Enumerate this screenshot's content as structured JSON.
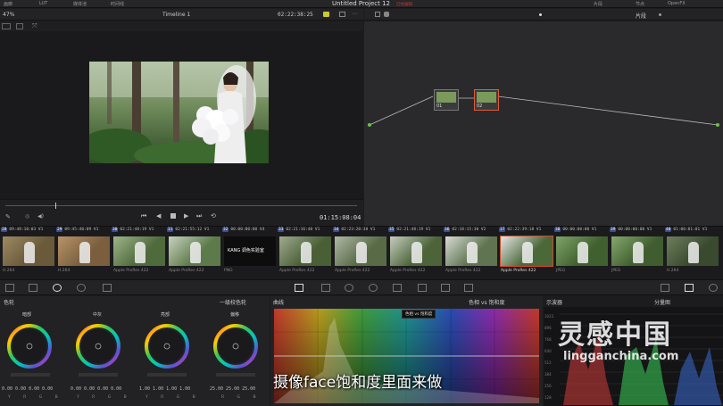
{
  "topbar": {
    "gallery": "画廊",
    "lut": "LUT",
    "media_pool": "媒体池",
    "timeline": "时间线",
    "project_title": "Untitled Project 12",
    "unsaved": "已经编辑",
    "clips": "片段",
    "nodes": "节点",
    "openfx": "OpenFX"
  },
  "viewer": {
    "zoom": "47%",
    "timeline_name": "Timeline 1",
    "timecode_top": "02:22:38:25",
    "timecode_main": "01:15:08:04"
  },
  "nodegraph": {
    "mode": "片段",
    "node1_label": "01",
    "node2_label": "02"
  },
  "clips": [
    {
      "num": "28",
      "tc": "09:48:10:03",
      "track": "V1",
      "codec": "H.264"
    },
    {
      "num": "29",
      "tc": "09:45:40:09",
      "track": "V1",
      "codec": "H.264"
    },
    {
      "num": "30",
      "tc": "02:21:48:19",
      "track": "V1",
      "codec": "Apple ProRes 422"
    },
    {
      "num": "31",
      "tc": "02:21:55:12",
      "track": "V1",
      "codec": "Apple ProRes 422"
    },
    {
      "num": "32",
      "tc": "00:00:00:00",
      "track": "V4",
      "codec": "PNG"
    },
    {
      "num": "33",
      "tc": "02:21:16:40",
      "track": "V1",
      "codec": "Apple ProRes 422"
    },
    {
      "num": "34",
      "tc": "02:23:20:38",
      "track": "V1",
      "codec": "Apple ProRes 422"
    },
    {
      "num": "35",
      "tc": "02:21:48:19",
      "track": "V1",
      "codec": "Apple ProRes 422"
    },
    {
      "num": "36",
      "tc": "02:18:15:30",
      "track": "V2",
      "codec": "Apple ProRes 422"
    },
    {
      "num": "37",
      "tc": "02:22:39:18",
      "track": "V1",
      "codec": "Apple ProRes 422"
    },
    {
      "num": "38",
      "tc": "00:00:00:00",
      "track": "V1",
      "codec": "JPEG"
    },
    {
      "num": "39",
      "tc": "00:00:00:00",
      "track": "V1",
      "codec": "JPEG"
    },
    {
      "num": "40",
      "tc": "01:00:01:01",
      "track": "V1",
      "codec": "H.264"
    }
  ],
  "png_card_text": "KANG 调色实验室",
  "wheels": {
    "title": "色轮",
    "mode": "一级校色轮",
    "lift": "暗部",
    "gamma": "中灰",
    "gain": "亮部",
    "offset": "偏移",
    "lift_vals": "0.00  0.00  0.00  0.00",
    "gamma_vals": "0.00  0.00  0.00  0.00",
    "gain_vals": "1.00  1.00  1.00  1.00",
    "offset_vals": "25.00  25.00  25.00",
    "ch4": "Y R G B",
    "ch3": "R G B"
  },
  "curves": {
    "title": "曲线",
    "mode": "色相 vs 饱和度",
    "tooltip": "色相 vs 饱和度"
  },
  "scope": {
    "title": "示波器",
    "mode": "分量图",
    "ticks": [
      "1023",
      "896",
      "768",
      "640",
      "512",
      "384",
      "256",
      "128"
    ]
  },
  "subtitle": "摄像face饱和度里面来做",
  "watermark": {
    "main": "灵感中国",
    "url": "lingganchina.com"
  }
}
